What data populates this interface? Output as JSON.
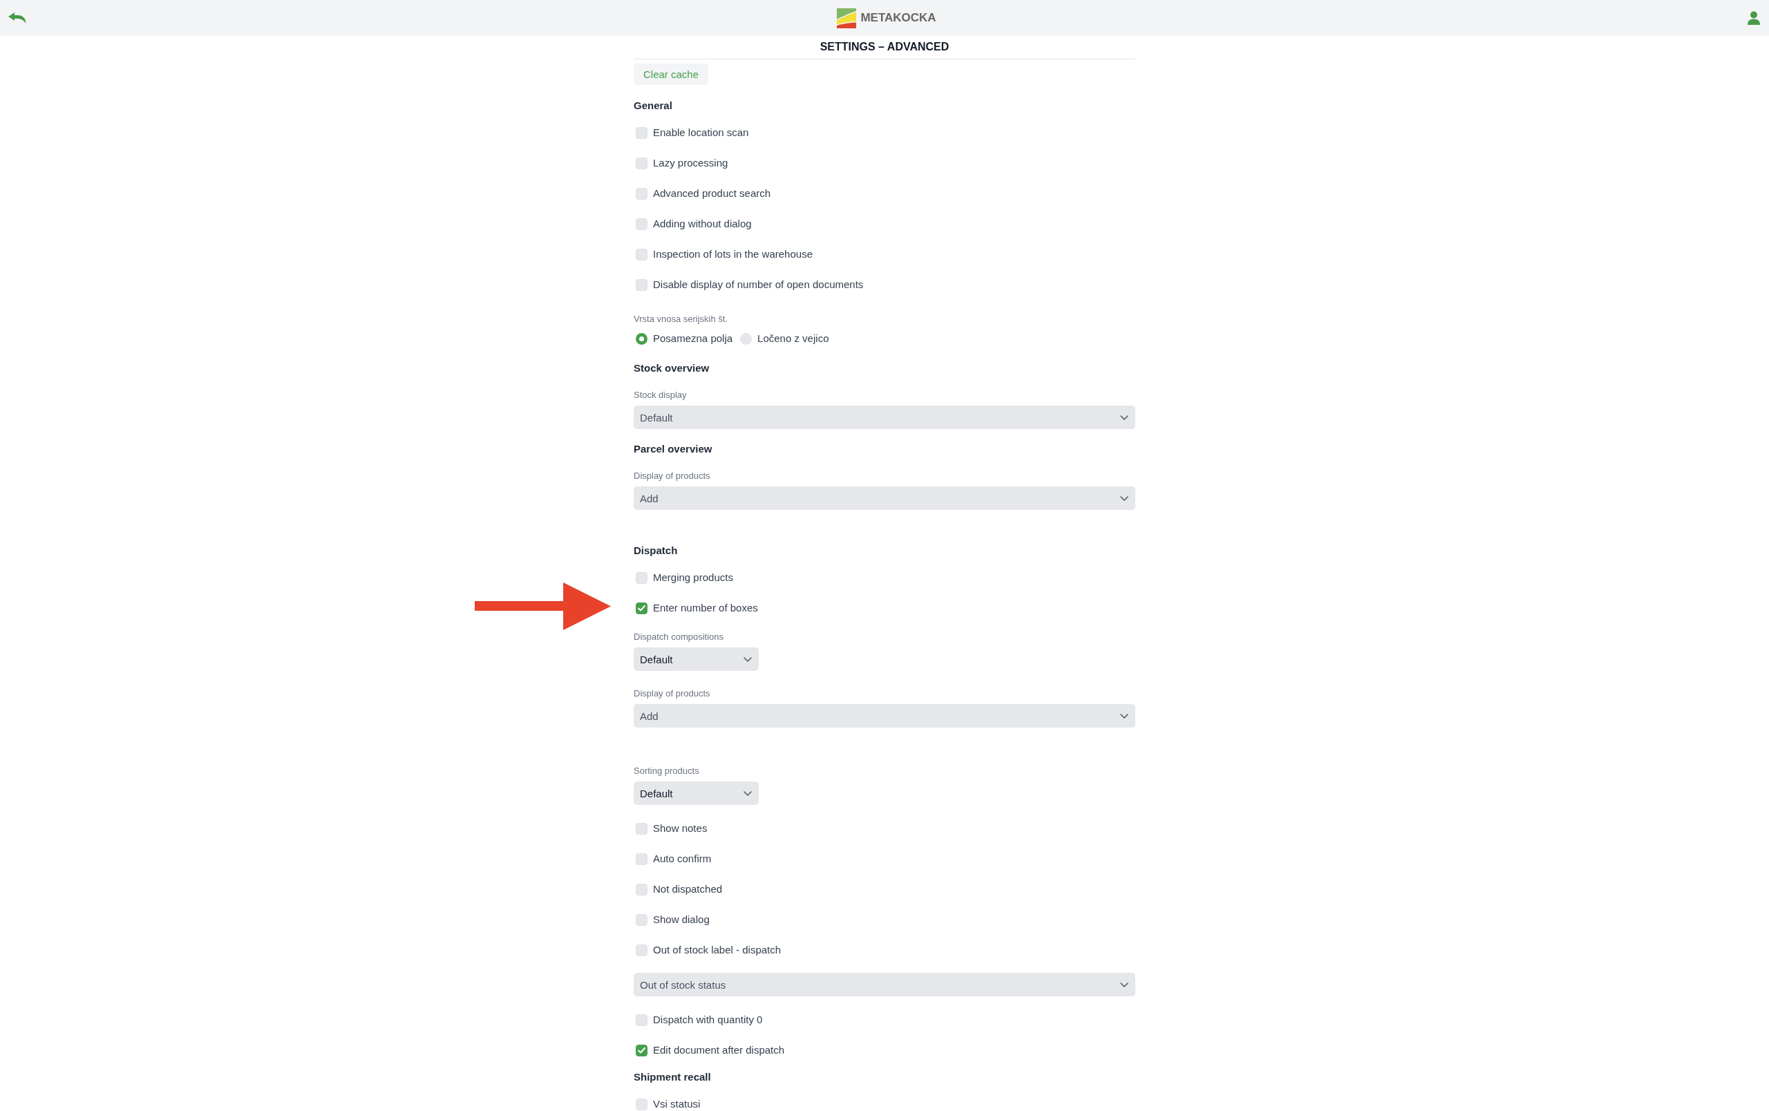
{
  "header": {
    "logo_text": "METAKOCKA"
  },
  "page_title": "SETTINGS – ADVANCED",
  "clear_cache_button": "Clear cache",
  "sections": [
    {
      "title": "General",
      "groups": [
        [
          {
            "kind": "checkbox",
            "label": "Enable location scan",
            "checked": false
          },
          {
            "kind": "checkbox",
            "label": "Lazy processing",
            "checked": false
          },
          {
            "kind": "checkbox",
            "label": "Advanced product search",
            "checked": false
          },
          {
            "kind": "checkbox",
            "label": "Adding without dialog",
            "checked": false
          },
          {
            "kind": "checkbox",
            "label": "Inspection of lots in the warehouse",
            "checked": false
          },
          {
            "kind": "checkbox",
            "label": "Disable display of number of open documents",
            "checked": false
          },
          {
            "kind": "radio_group",
            "label": "Vrsta vnosa serijskih št.",
            "options": [
              {
                "label": "Posamezna polja",
                "selected": true
              },
              {
                "label": "Ločeno z vejico",
                "selected": false
              }
            ]
          }
        ]
      ]
    },
    {
      "title": "Stock overview",
      "groups": [
        [
          {
            "kind": "select",
            "label": "Stock display",
            "value": "Default"
          }
        ]
      ]
    },
    {
      "title": "Parcel overview",
      "groups": [
        [
          {
            "kind": "select",
            "label": "Display of products",
            "value": "Add"
          }
        ]
      ]
    },
    {
      "title": "Dispatch",
      "groups": [
        [
          {
            "kind": "checkbox",
            "label": "Merging products",
            "checked": false
          },
          {
            "kind": "checkbox",
            "label": "Enter number of boxes",
            "checked": true
          },
          {
            "kind": "compact_select",
            "label": "Dispatch compositions",
            "value": "Default"
          },
          {
            "kind": "select",
            "label": "Display of products",
            "value": "Add"
          }
        ],
        [
          {
            "kind": "compact_select",
            "label": "Sorting products",
            "value": "Default"
          },
          {
            "kind": "checkbox",
            "label": "Show notes",
            "checked": false
          },
          {
            "kind": "checkbox",
            "label": "Auto confirm",
            "checked": false
          },
          {
            "kind": "checkbox",
            "label": "Not dispatched",
            "checked": false
          },
          {
            "kind": "checkbox",
            "label": "Show dialog",
            "checked": false
          },
          {
            "kind": "checkbox",
            "label": "Out of stock label - dispatch",
            "checked": false
          },
          {
            "kind": "select",
            "value": "Out of stock status"
          },
          {
            "kind": "checkbox",
            "label": "Dispatch with quantity 0",
            "checked": false
          },
          {
            "kind": "checkbox",
            "label": "Edit document after dispatch",
            "checked": true
          }
        ]
      ]
    },
    {
      "title": "Shipment recall",
      "groups": [
        [
          {
            "kind": "checkbox",
            "label": "Vsi statusi",
            "checked": false
          }
        ]
      ]
    }
  ]
}
